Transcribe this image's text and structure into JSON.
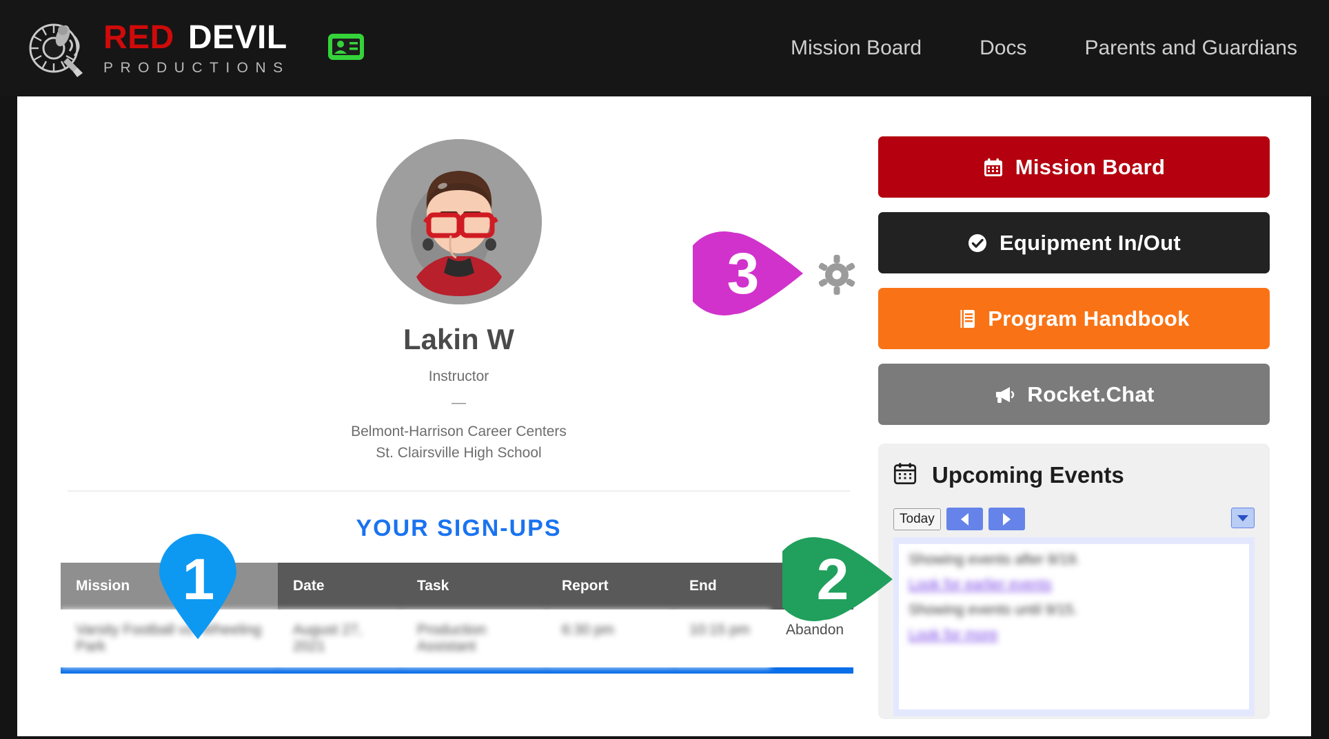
{
  "header": {
    "brand": {
      "word1": "RED",
      "word2": "DEVIL",
      "tagline": "PRODUCTIONS"
    },
    "id_badge_icon": "id-card-icon",
    "nav": [
      {
        "label": "Mission Board"
      },
      {
        "label": "Docs"
      },
      {
        "label": "Parents and Guardians"
      }
    ]
  },
  "profile": {
    "avatar_icon": "user-avatar",
    "name": "Lakin W",
    "role": "Instructor",
    "separator": "—",
    "organization": "Belmont-Harrison Career Centers",
    "school": "St. Clairsville High School",
    "settings_icon": "gear-icon"
  },
  "signups": {
    "title": "YOUR SIGN-UPS",
    "columns": [
      "Mission",
      "Date",
      "Task",
      "Report",
      "End",
      ""
    ],
    "rows": [
      {
        "mission": "Varsity Football vs. Wheeling Park",
        "date": "August 27, 2021",
        "task": "Production Assistant",
        "report": "6:30 pm",
        "end": "10:15 pm",
        "action": "Abandon"
      }
    ]
  },
  "sidebar": {
    "buttons": [
      {
        "label": "Mission Board",
        "icon": "calendar-icon",
        "color": "#b4000f"
      },
      {
        "label": "Equipment In/Out",
        "icon": "check-circle-icon",
        "color": "#222222"
      },
      {
        "label": "Program Handbook",
        "icon": "book-icon",
        "color": "#f97316"
      },
      {
        "label": "Rocket.Chat",
        "icon": "megaphone-icon",
        "color": "#7b7b7b"
      }
    ]
  },
  "events": {
    "icon": "calendar-icon",
    "title": "Upcoming Events",
    "today_label": "Today",
    "prev_label": "◀",
    "next_label": "▶",
    "dropdown_icon": "chevron-down-icon",
    "lines": [
      "Showing events after 8/19.",
      "Look for earlier events",
      "Showing events until 9/15.",
      "Look for more"
    ]
  },
  "callouts": [
    {
      "number": "1",
      "color": "#0d99f2",
      "direction": "down"
    },
    {
      "number": "2",
      "color": "#20a05c",
      "direction": "right"
    },
    {
      "number": "3",
      "color": "#d132cc",
      "direction": "right"
    }
  ]
}
